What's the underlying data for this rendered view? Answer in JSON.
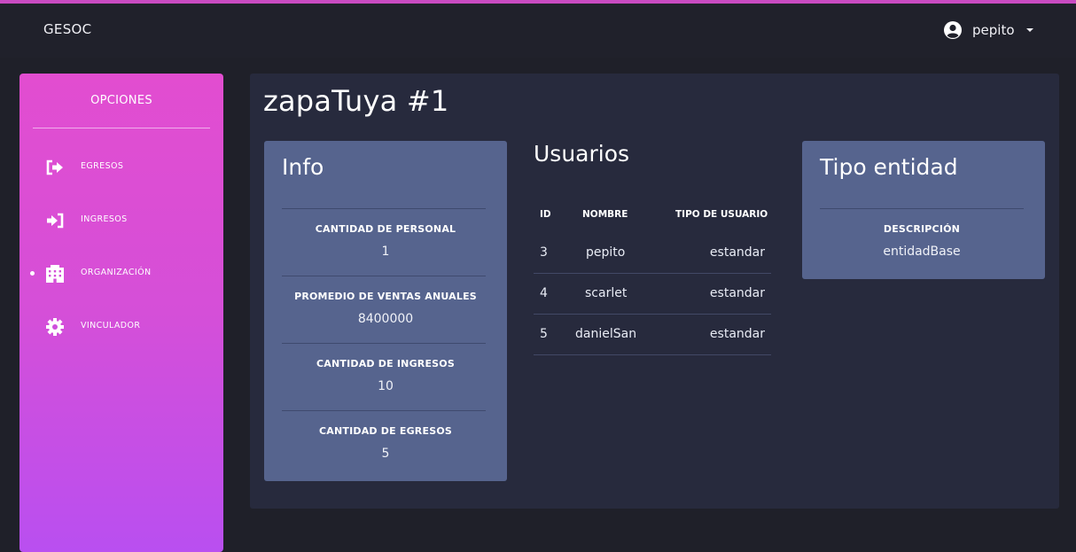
{
  "navbar": {
    "brand": "GESOC",
    "username": "pepito"
  },
  "sidebar": {
    "title": "OPCIONES",
    "items": [
      {
        "label": "EGRESOS",
        "icon": "sign-out-icon",
        "active": false
      },
      {
        "label": "INGRESOS",
        "icon": "sign-in-icon",
        "active": false
      },
      {
        "label": "ORGANIZACIÓN",
        "icon": "building-icon",
        "active": true
      },
      {
        "label": "VINCULADOR",
        "icon": "gear-icon",
        "active": false
      }
    ]
  },
  "main": {
    "title": "zapaTuya #1"
  },
  "info_card": {
    "title": "Info",
    "fields": [
      {
        "label": "CANTIDAD DE PERSONAL",
        "value": "1"
      },
      {
        "label": "PROMEDIO DE VENTAS ANUALES",
        "value": "8400000"
      },
      {
        "label": "CANTIDAD DE INGRESOS",
        "value": "10"
      },
      {
        "label": "CANTIDAD DE EGRESOS",
        "value": "5"
      }
    ]
  },
  "users": {
    "title": "Usuarios",
    "columns": [
      "ID",
      "NOMBRE",
      "TIPO DE USUARIO"
    ],
    "rows": [
      {
        "id": "3",
        "nombre": "pepito",
        "tipo": "estandar"
      },
      {
        "id": "4",
        "nombre": "scarlet",
        "tipo": "estandar"
      },
      {
        "id": "5",
        "nombre": "danielSan",
        "tipo": "estandar"
      }
    ]
  },
  "entity_card": {
    "title": "Tipo entidad",
    "field_label": "DESCRIPCIÓN",
    "field_value": "entidadBase"
  },
  "colors": {
    "accent_pink": "#e24dd0",
    "accent_purple": "#b94ff0",
    "card": "#56648e",
    "panel": "#272a3d",
    "background": "#1f2029"
  }
}
